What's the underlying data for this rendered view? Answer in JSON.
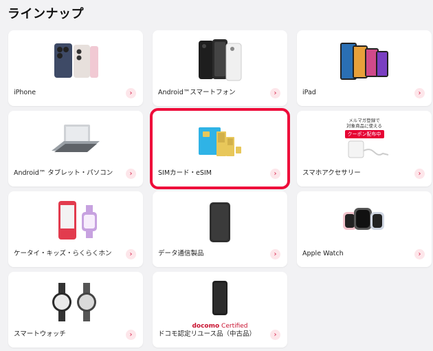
{
  "page": {
    "title": "ラインナップ"
  },
  "cards": [
    {
      "label": "iPhone"
    },
    {
      "label": "Android™スマートフォン"
    },
    {
      "label": "iPad"
    },
    {
      "label": "Android™ タブレット・パソコン"
    },
    {
      "label": "SIMカード・eSIM"
    },
    {
      "label": "スマホアクセサリー",
      "promo_line1": "メルマガ登録で",
      "promo_line2": "対象商品に使える",
      "promo_badge": "クーポン配布中"
    },
    {
      "label": "ケータイ・キッズ・らくらくホン"
    },
    {
      "label": "データ通信製品"
    },
    {
      "label": "Apple Watch"
    },
    {
      "label": "スマートウォッチ"
    },
    {
      "label": "ドコモ認定リユース品（中古品）",
      "brand": "docomo",
      "brand_suffix": " Certified"
    }
  ],
  "arrow_glyph": "›",
  "colors": {
    "highlight": "#ee0b3a",
    "arrow": "#d6204a",
    "arrow_bg": "#fde6ea"
  },
  "icons": [
    "iphone-image",
    "android-phone-image",
    "ipad-image",
    "tablet-pc-image",
    "sim-card-image",
    "accessory-image",
    "kids-phone-image",
    "router-image",
    "apple-watch-image",
    "smartwatch-image",
    "used-phone-image"
  ]
}
